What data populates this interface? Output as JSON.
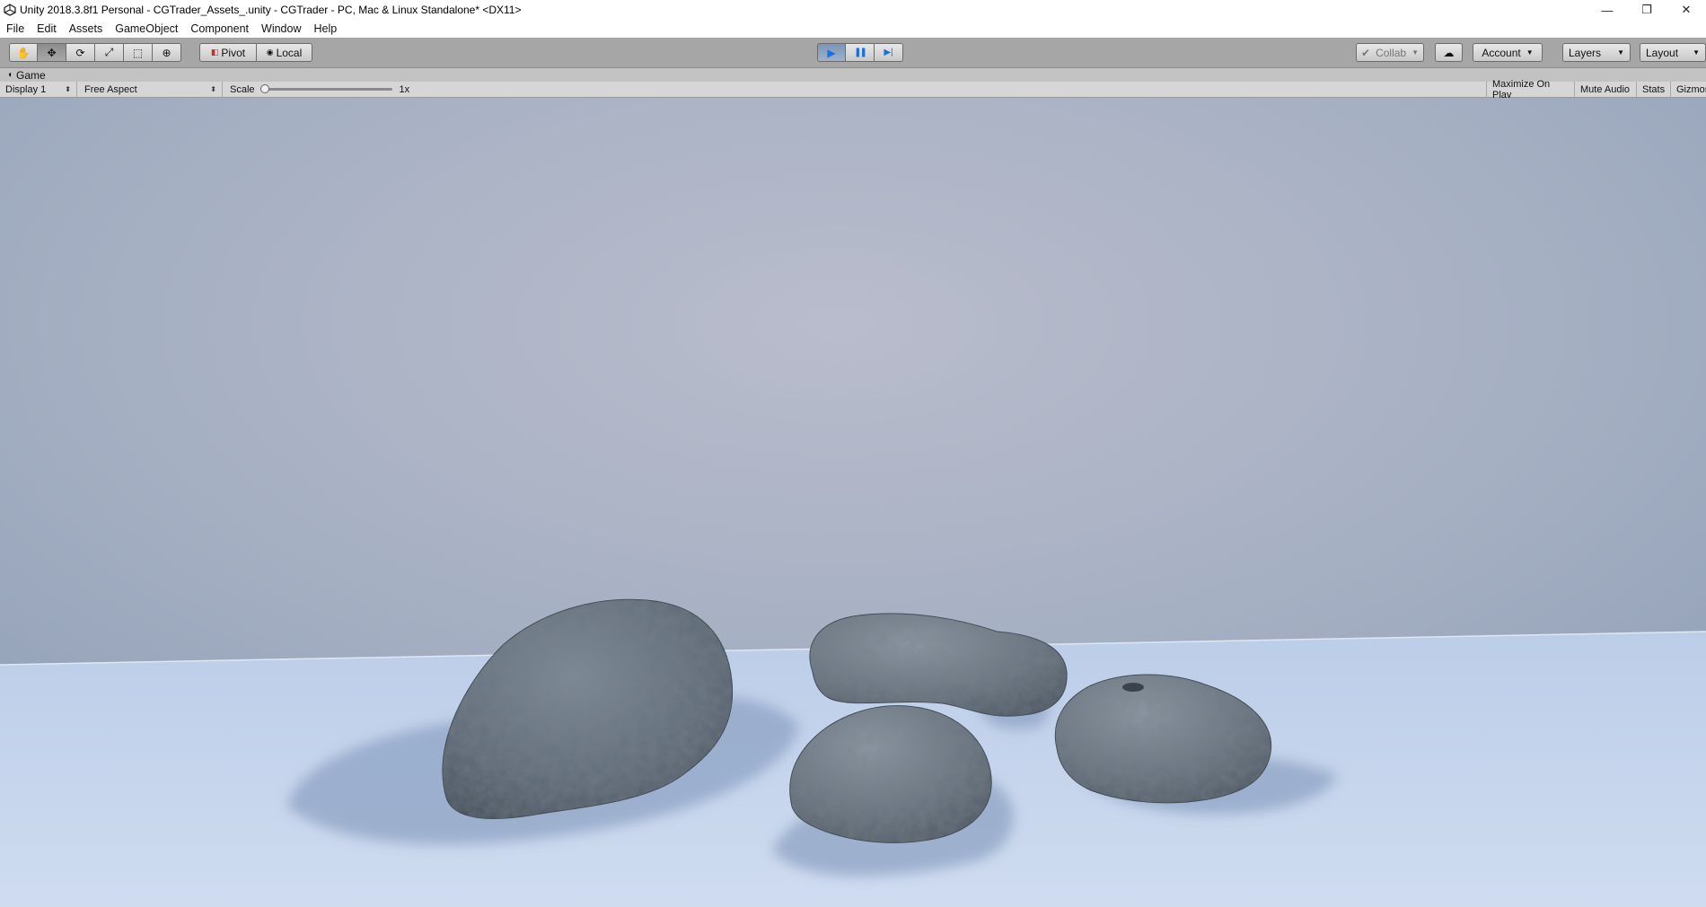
{
  "window": {
    "title": "Unity 2018.3.8f1 Personal - CGTrader_Assets_.unity - CGTrader - PC, Mac & Linux Standalone* <DX11>",
    "minimize_glyph": "—",
    "restore_glyph": "❐",
    "close_glyph": "✕"
  },
  "menu": [
    "File",
    "Edit",
    "Assets",
    "GameObject",
    "Component",
    "Window",
    "Help"
  ],
  "toolbar": {
    "tools": [
      {
        "name": "hand-tool",
        "glyph": "✋"
      },
      {
        "name": "move-tool",
        "glyph": "✥"
      },
      {
        "name": "rotate-tool",
        "glyph": "⟳"
      },
      {
        "name": "scale-tool",
        "glyph": "⤢"
      },
      {
        "name": "rect-tool",
        "glyph": "⬚"
      },
      {
        "name": "transform-tool",
        "glyph": "⊕"
      }
    ],
    "active_tool_index": 1,
    "pivot_label": "Pivot",
    "local_label": "Local",
    "play_glyph": "▶",
    "pause_glyph": "❚❚",
    "step_glyph": "▶|",
    "collab_label": "Collab",
    "account_label": "Account",
    "layers_label": "Layers",
    "layout_label": "Layout"
  },
  "game_view": {
    "tab_label": "Game",
    "display_label": "Display 1",
    "aspect_label": "Free Aspect",
    "scale_label": "Scale",
    "scale_value": "1x",
    "maximize_label": "Maximize On Play",
    "mute_label": "Mute Audio",
    "stats_label": "Stats",
    "gizmos_label": "Gizmos"
  },
  "colors": {
    "sky_center": "#b9bccc",
    "sky_edge": "#92a2b8",
    "floor": "#c6d6ee",
    "rock": "#5e6c79",
    "shadow": "#8ea3c4",
    "play_active": "#1d6fe0"
  }
}
